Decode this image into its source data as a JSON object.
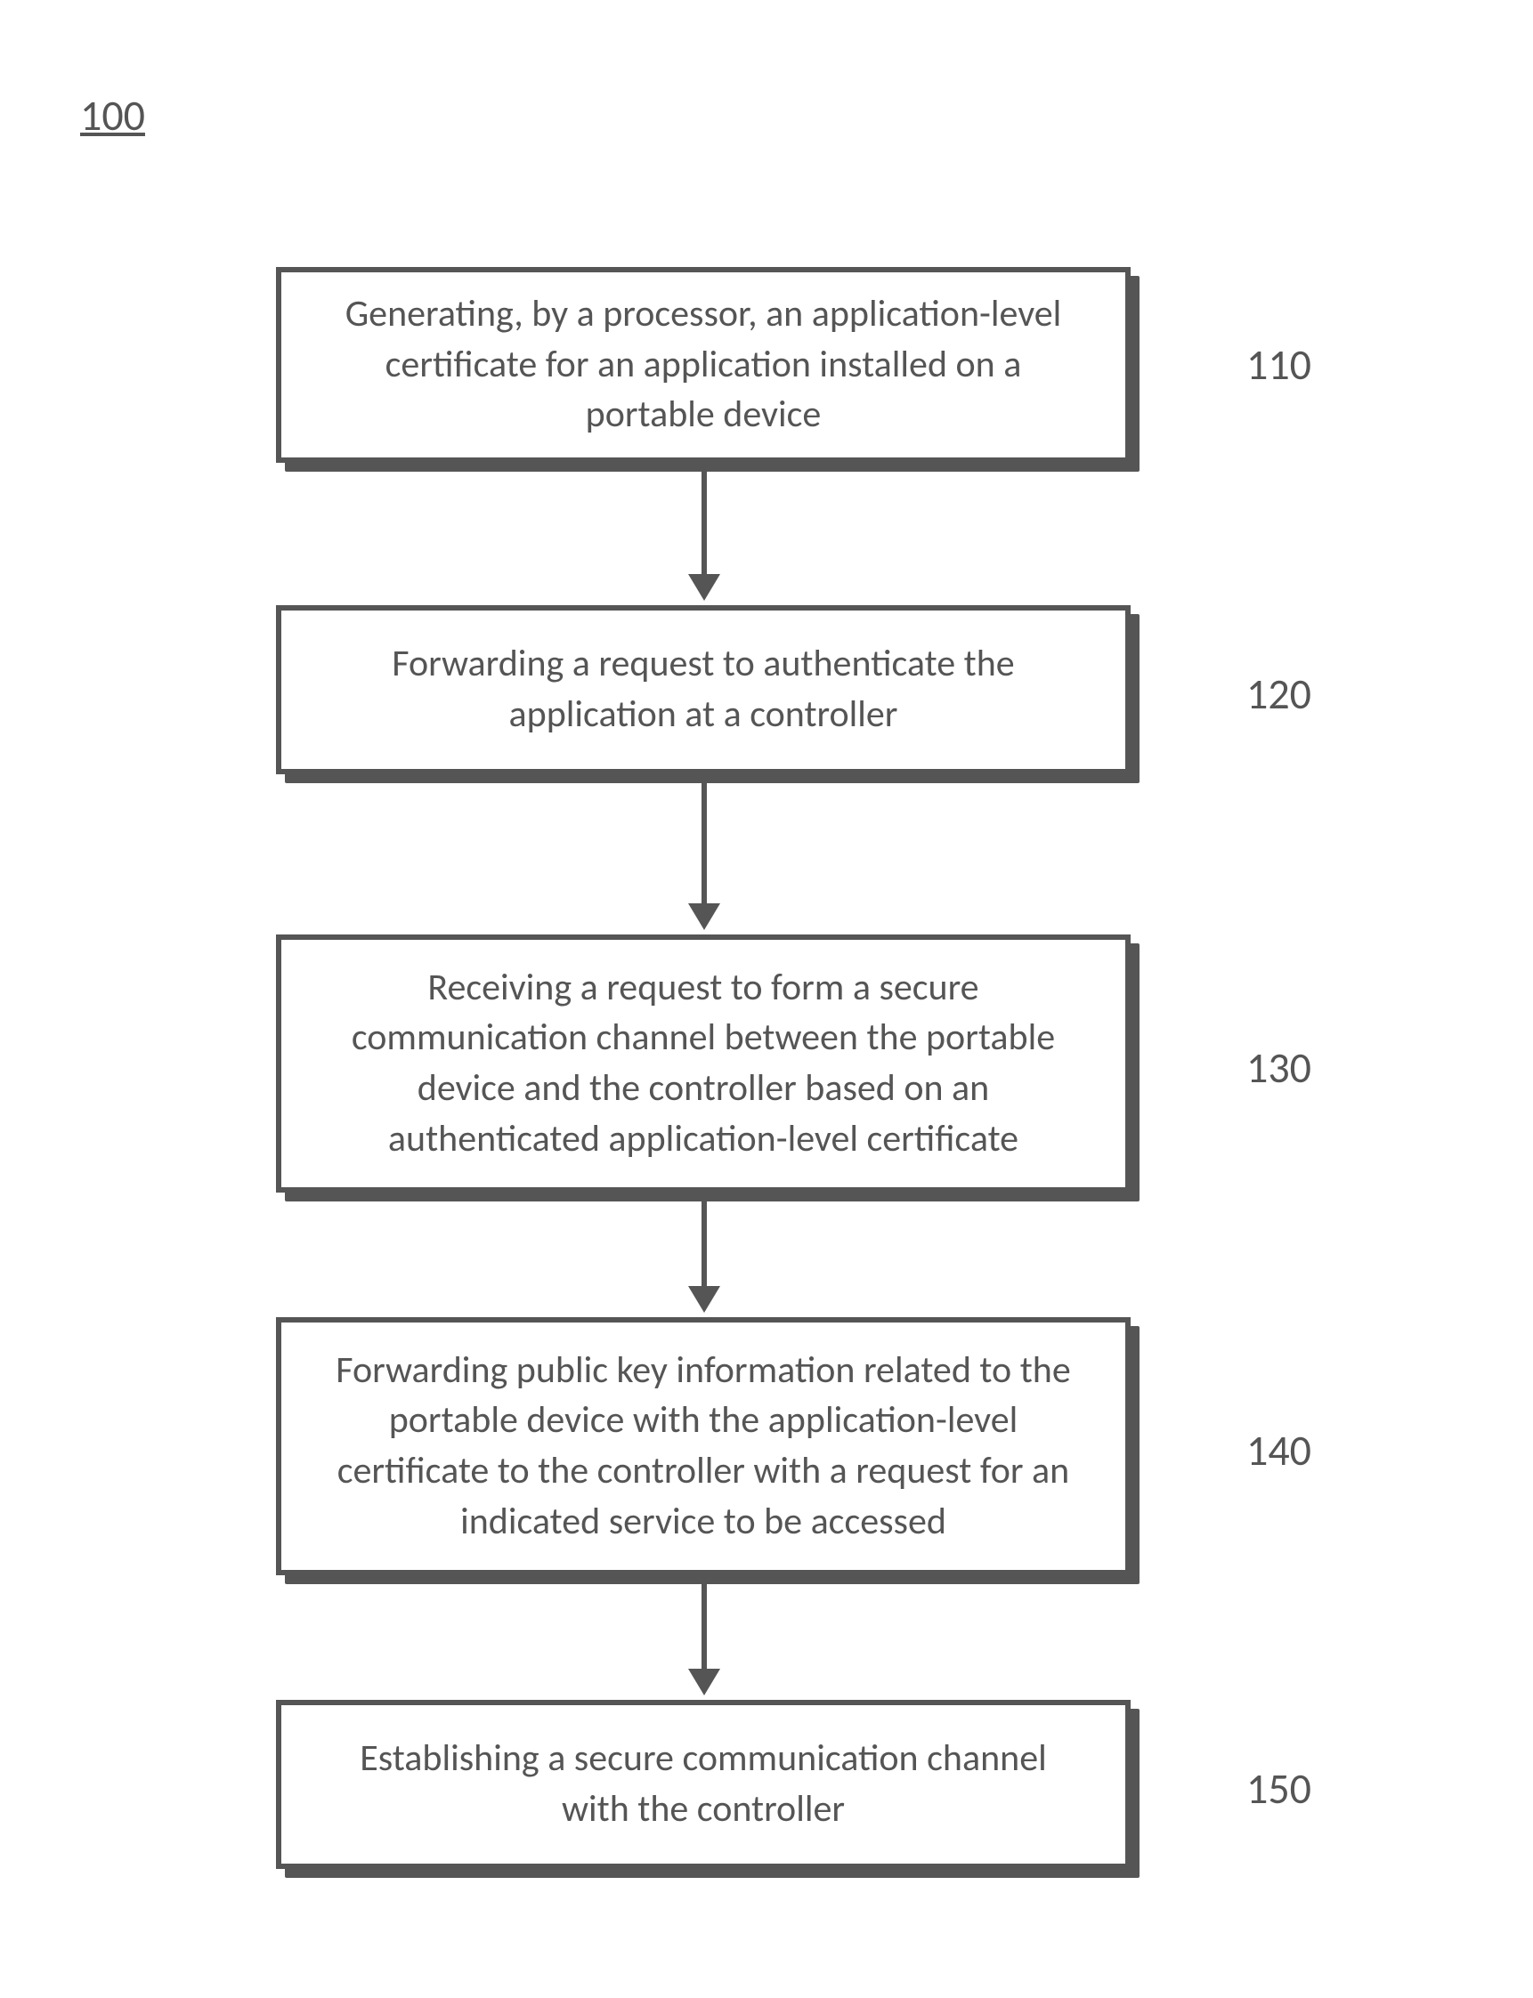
{
  "figure_label": "100",
  "steps": [
    {
      "num": "110",
      "text": "Generating, by a processor, an application-level certificate for an application installed on a portable device"
    },
    {
      "num": "120",
      "text": "Forwarding a request to authenticate the application at a controller"
    },
    {
      "num": "130",
      "text": "Receiving a request to form a secure communication channel between the portable device and the controller based on an authenticated application-level certificate"
    },
    {
      "num": "140",
      "text": "Forwarding public key information related to the portable device with the application-level certificate to the controller with a request for an indicated service to be accessed"
    },
    {
      "num": "150",
      "text": "Establishing a secure communication channel with the controller"
    }
  ]
}
